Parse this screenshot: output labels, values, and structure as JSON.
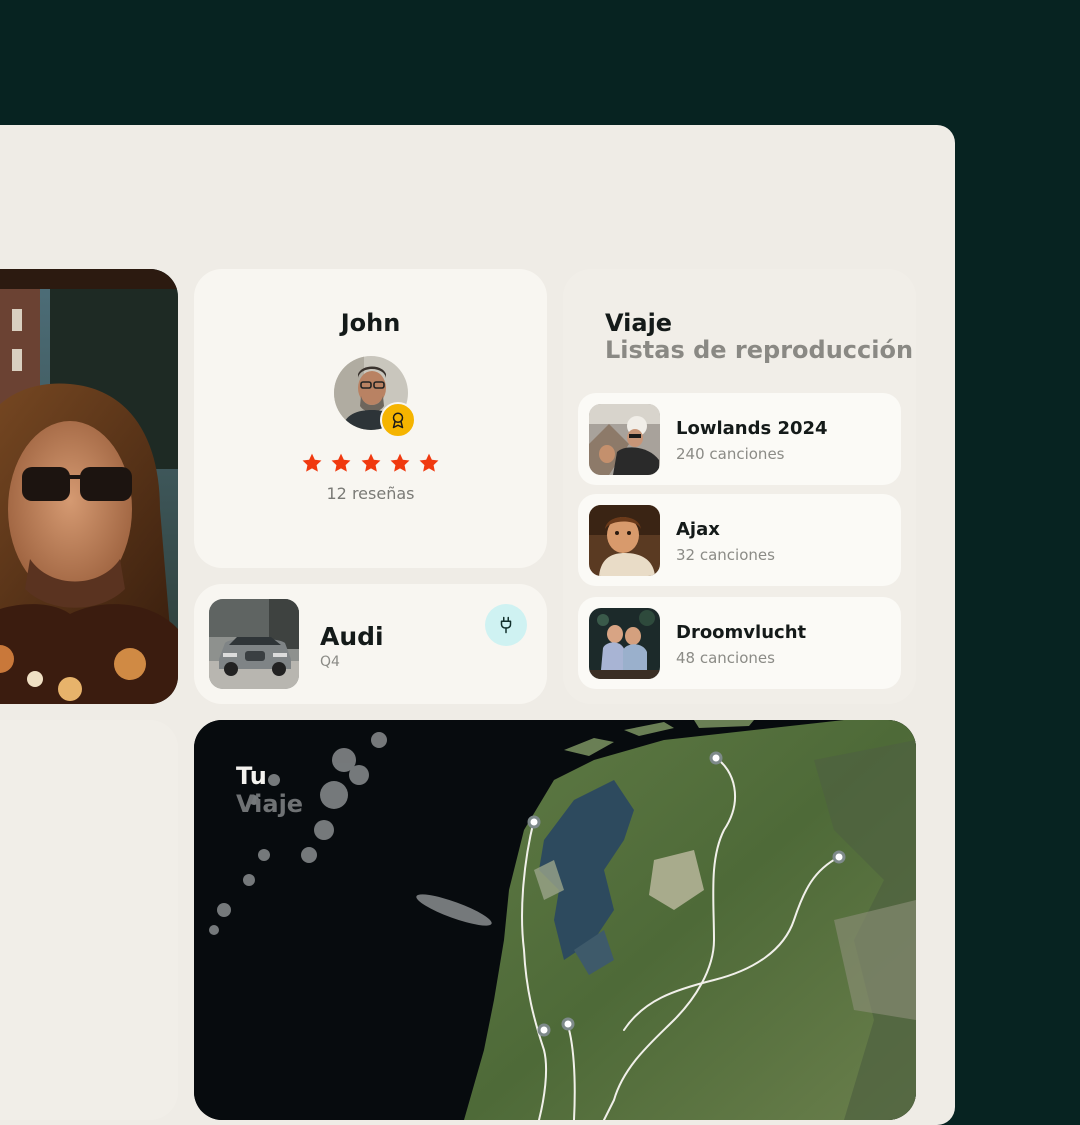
{
  "driver": {
    "name": "John",
    "rating": 5,
    "reviews_label": "12 reseñas"
  },
  "car": {
    "brand": "Audi",
    "model": "Q4"
  },
  "playlists": {
    "title": "Viaje",
    "subtitle": "Listas de reproducción",
    "items": [
      {
        "name": "Lowlands 2024",
        "count": "240 canciones"
      },
      {
        "name": "Ajax",
        "count": "32 canciones"
      },
      {
        "name": "Droomvlucht",
        "count": "48 canciones"
      }
    ]
  },
  "map": {
    "title": "Tu",
    "subtitle": "Viaje"
  },
  "colors": {
    "background": "#072321",
    "panel": "#efece6",
    "star": "#f0390f",
    "badge": "#f5b400",
    "plug_button": "#cff2f2"
  }
}
